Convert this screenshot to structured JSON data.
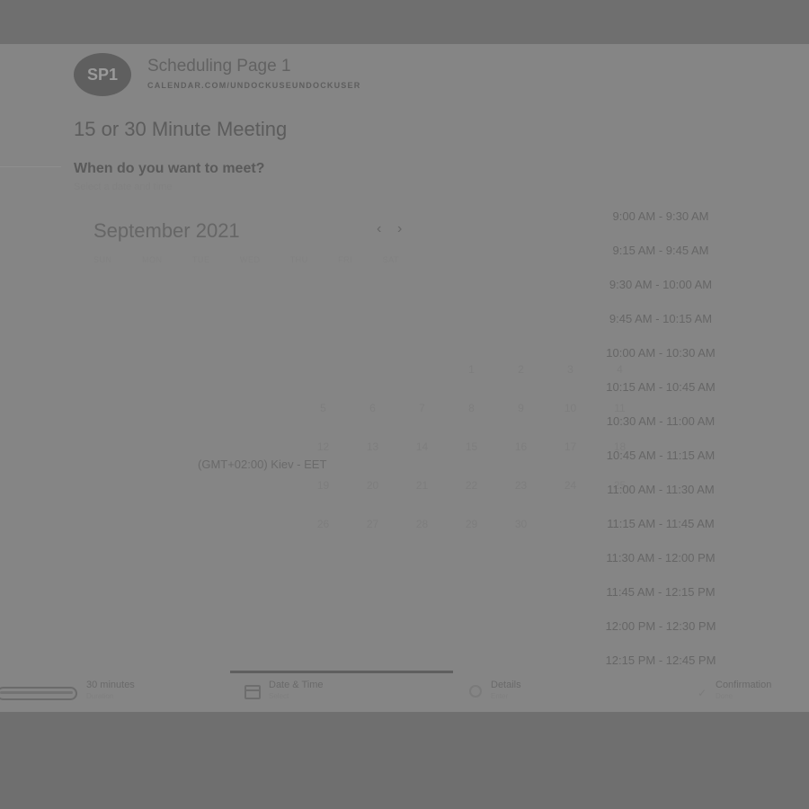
{
  "header": {
    "avatar_initials": "SP1",
    "page_name": "Scheduling Page 1",
    "page_url": "CALENDAR.COM/UNDOCKUSEUNDOCKUSER"
  },
  "meeting": {
    "title": "15 or 30 Minute Meeting",
    "question": "When do you want to meet?",
    "question_sub": "Select a date and time"
  },
  "calendar": {
    "month_label": "September 2021",
    "prev_icon": "chevron-left-icon",
    "next_icon": "chevron-right-icon",
    "prev_glyph": "‹",
    "next_glyph": "›",
    "weekdays": [
      "SUN",
      "MON",
      "TUE",
      "WED",
      "THU",
      "FRI",
      "SAT"
    ],
    "weeks": [
      [
        "",
        "",
        "",
        "1",
        "2",
        "3",
        "4"
      ],
      [
        "5",
        "6",
        "7",
        "8",
        "9",
        "10",
        "11"
      ],
      [
        "12",
        "13",
        "14",
        "15",
        "16",
        "17",
        "18"
      ],
      [
        "19",
        "20",
        "21",
        "22",
        "23",
        "24",
        "25"
      ],
      [
        "26",
        "27",
        "28",
        "29",
        "30",
        "",
        ""
      ]
    ]
  },
  "timezone": "(GMT+02:00) Kiev - EET",
  "time_slots": [
    "9:00 AM - 9:30 AM",
    "9:15 AM - 9:45 AM",
    "9:30 AM - 10:00 AM",
    "9:45 AM - 10:15 AM",
    "10:00 AM - 10:30 AM",
    "10:15 AM - 10:45 AM",
    "10:30 AM - 11:00 AM",
    "10:45 AM - 11:15 AM",
    "11:00 AM - 11:30 AM",
    "11:15 AM - 11:45 AM",
    "11:30 AM - 12:00 PM",
    "11:45 AM - 12:15 PM",
    "12:00 PM - 12:30 PM",
    "12:15 PM - 12:45 PM"
  ],
  "steps": {
    "duration": {
      "title": "30 minutes",
      "sub": "Duration"
    },
    "datetime": {
      "title": "Date & Time",
      "sub": "Select"
    },
    "details": {
      "title": "Details",
      "sub": "Enter"
    },
    "confirm": {
      "title": "Confirmation",
      "sub": "Done"
    }
  },
  "colors": {
    "overlay": "#858585",
    "backdrop": "#6f6f6f",
    "avatar": "#5f5f5f"
  }
}
